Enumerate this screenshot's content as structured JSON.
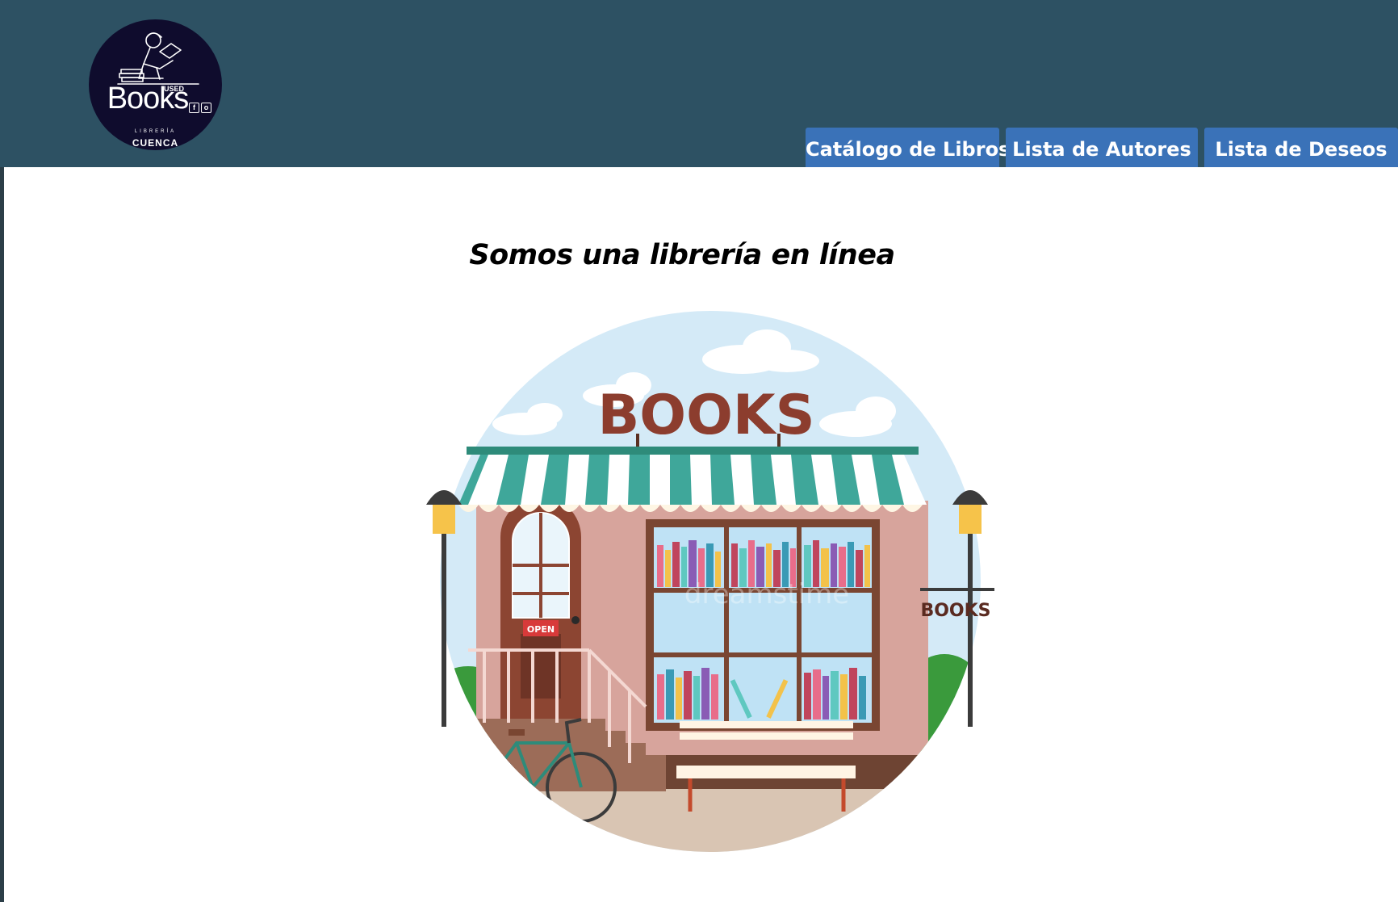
{
  "logo": {
    "brand": "Books",
    "used": "USED",
    "libreria": "LIBRERÍA",
    "city": "CUENCA"
  },
  "nav": {
    "tabs": [
      {
        "label": "Catálogo de Libros"
      },
      {
        "label": "Lista de Autores"
      },
      {
        "label": "Lista de Deseos"
      }
    ]
  },
  "main": {
    "heading": "Somos una librería en línea",
    "illustration": {
      "sign": "BOOKS",
      "door_sign": "OPEN",
      "hanging_sign": "BOOKS",
      "watermark": "dreamstime"
    }
  },
  "colors": {
    "header_bg": "#2d5163",
    "tab_bg": "#3a72b8",
    "logo_bg": "#0f0c2d"
  }
}
